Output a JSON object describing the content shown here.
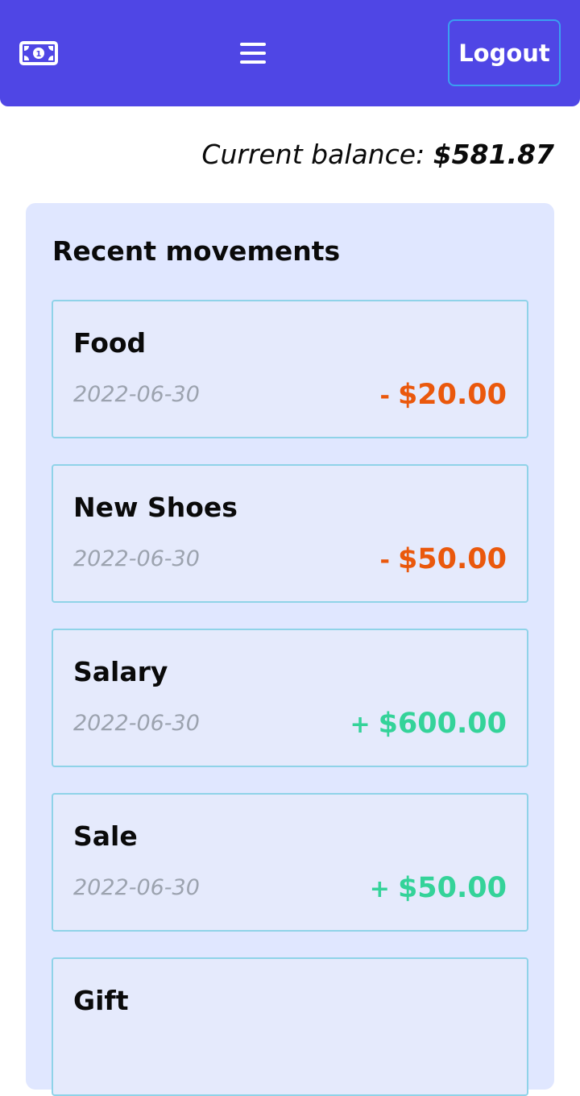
{
  "header": {
    "logo_icon": "banknote-icon",
    "menu_icon": "hamburger-menu-icon",
    "logout_label": "Logout",
    "colors": {
      "bar": "#4f46e5",
      "logout_border": "#3aa0f0"
    }
  },
  "balance": {
    "label": "Current balance:",
    "amount": "$581.87"
  },
  "movements": {
    "title": "Recent movements",
    "items": [
      {
        "name": "Food",
        "date": "2022-06-30",
        "sign": "-",
        "amount": "$20.00",
        "type": "expense"
      },
      {
        "name": "New Shoes",
        "date": "2022-06-30",
        "sign": "-",
        "amount": "$50.00",
        "type": "expense"
      },
      {
        "name": "Salary",
        "date": "2022-06-30",
        "sign": "+",
        "amount": "$600.00",
        "type": "income"
      },
      {
        "name": "Sale",
        "date": "2022-06-30",
        "sign": "+",
        "amount": "$50.00",
        "type": "income"
      },
      {
        "name": "Gift",
        "date": "",
        "sign": "",
        "amount": "",
        "type": "income"
      }
    ],
    "colors": {
      "expense": "#ea580c",
      "income": "#34d399",
      "panel": "#e0e7ff",
      "card_border": "#8fd3e8"
    }
  }
}
